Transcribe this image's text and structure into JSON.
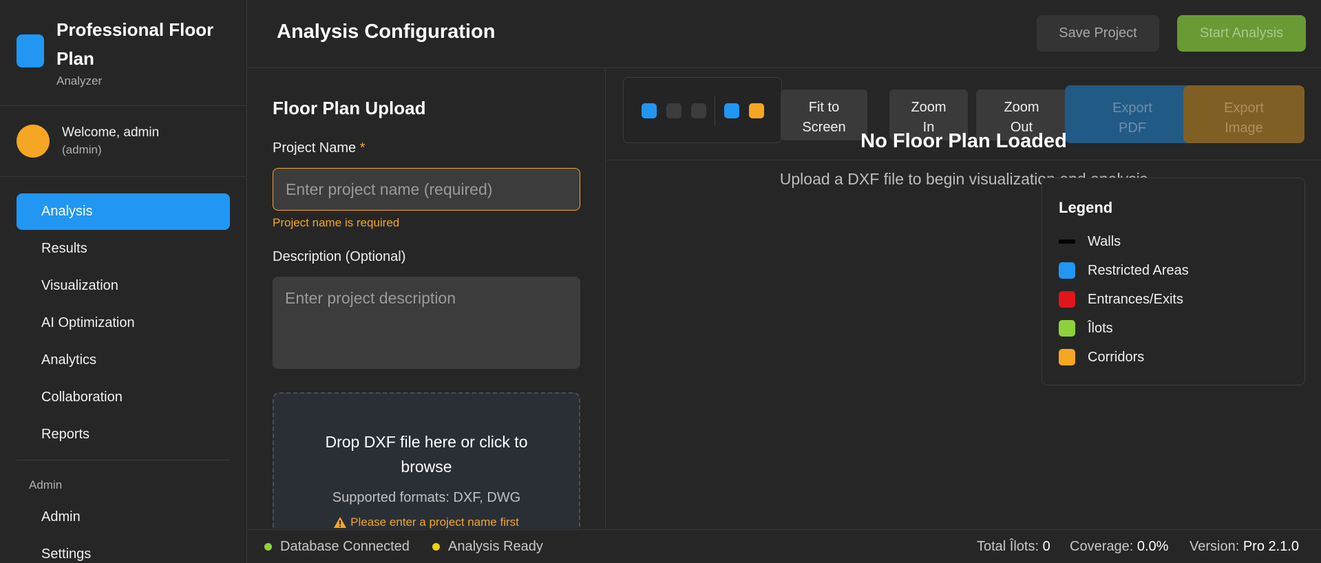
{
  "brand": {
    "title": "Professional Floor Plan",
    "subtitle": "Analyzer",
    "accent": "#2196f3"
  },
  "user": {
    "welcome": "Welcome, admin",
    "role": "(admin)"
  },
  "nav": {
    "items": [
      {
        "label": "Analysis",
        "active": true
      },
      {
        "label": "Results"
      },
      {
        "label": "Visualization"
      },
      {
        "label": "AI Optimization"
      },
      {
        "label": "Analytics"
      },
      {
        "label": "Collaboration"
      },
      {
        "label": "Reports"
      }
    ],
    "admin_section": "Admin",
    "admin_items": [
      {
        "label": "Admin"
      },
      {
        "label": "Settings"
      }
    ]
  },
  "header": {
    "title": "Analysis Configuration",
    "save_label": "Save Project",
    "start_label": "Start Analysis"
  },
  "config": {
    "title": "Floor Plan Upload",
    "project_name_label": "Project Name",
    "required_mark": "*",
    "project_name_value": "",
    "project_name_placeholder": "Enter project name (required)",
    "project_name_error": "Project name is required",
    "description_label": "Description (Optional)",
    "description_value": "",
    "description_placeholder": "Enter project description",
    "drop_text": "Drop DXF file here or click to browse",
    "drop_formats": "Supported formats: DXF, DWG",
    "drop_warning": "Please enter a project name first"
  },
  "viewer": {
    "tool_colors": [
      "#2196f3",
      "#3c3c3c",
      "#3c3c3c",
      "#2196f3",
      "#f5a623"
    ],
    "fit_label_1": "Fit to",
    "fit_label_2": "Screen",
    "zoom_in_1": "Zoom",
    "zoom_in_2": "In",
    "zoom_out_1": "Zoom",
    "zoom_out_2": "Out",
    "export_pdf_1": "Export",
    "export_pdf_2": "PDF",
    "export_img_1": "Export",
    "export_img_2": "Image",
    "empty_title": "No Floor Plan Loaded",
    "empty_sub": "Upload a DXF file to begin visualization and analysis"
  },
  "legend": {
    "title": "Legend",
    "items": [
      {
        "label": "Walls",
        "color": "#000000"
      },
      {
        "label": "Restricted Areas",
        "color": "#2196f3"
      },
      {
        "label": "Entrances/Exits",
        "color": "#e0161a"
      },
      {
        "label": "Îlots",
        "color": "#8fd13a"
      },
      {
        "label": "Corridors",
        "color": "#f5a623"
      }
    ]
  },
  "footer": {
    "db_status": "Database Connected",
    "db_color": "#8fd13a",
    "analysis_status": "Analysis Ready",
    "analysis_color": "#f0d000",
    "total_ilots_label": "Total Îlots:",
    "total_ilots_value": "0",
    "coverage_label": "Coverage:",
    "coverage_value": "0.0%",
    "version_label": "Version:",
    "version_value": "Pro 2.1.0"
  }
}
